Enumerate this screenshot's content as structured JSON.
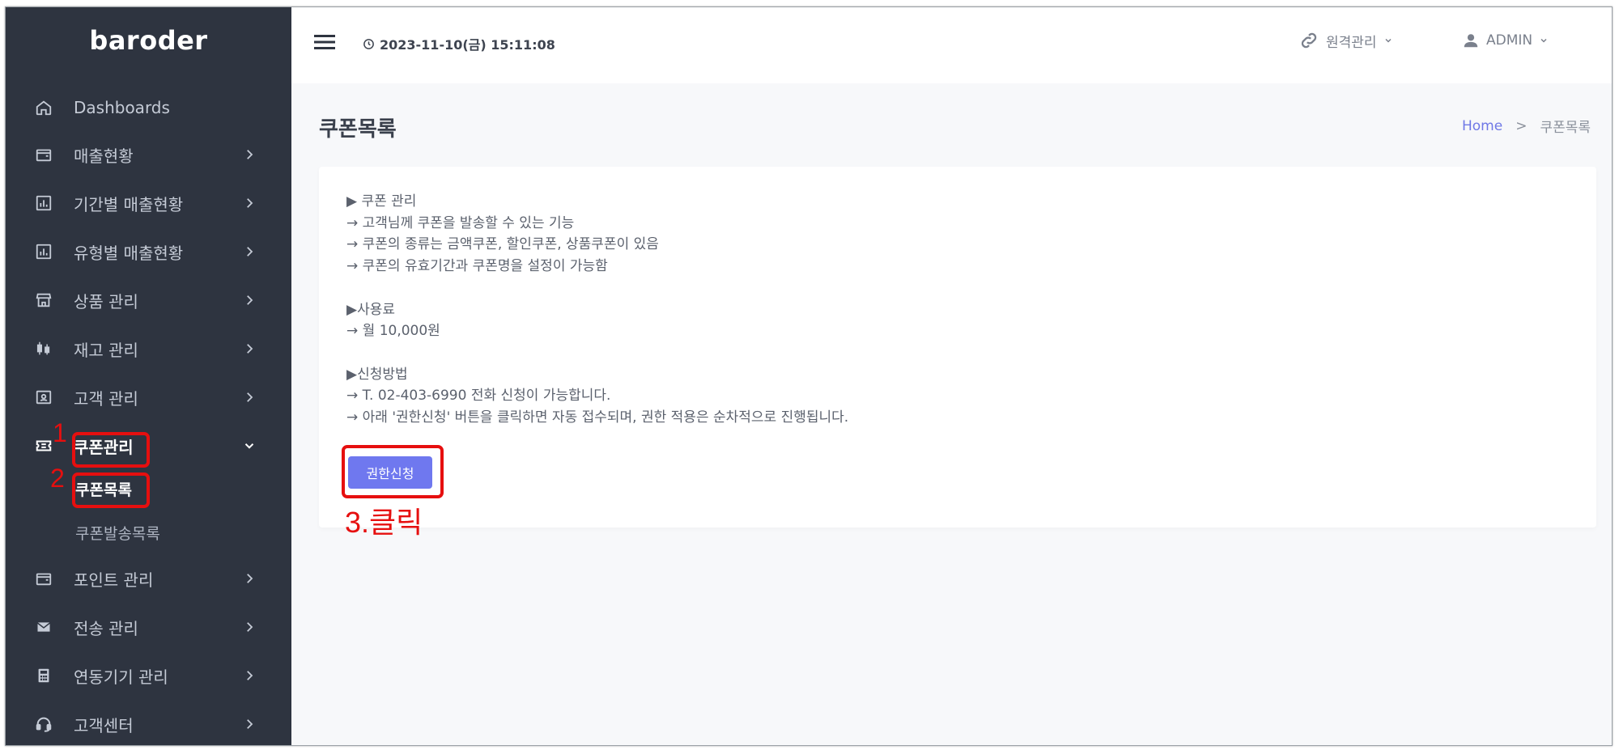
{
  "app": {
    "logo": "baroder"
  },
  "sidebar": {
    "items": [
      {
        "label": "Dashboards",
        "icon": "home-icon",
        "chevron": false
      },
      {
        "label": "매출현황",
        "icon": "wallet-icon",
        "chevron": true
      },
      {
        "label": "기간별 매출현황",
        "icon": "bar-chart-icon",
        "chevron": true
      },
      {
        "label": "유형별 매출현황",
        "icon": "bar-chart-icon",
        "chevron": true
      },
      {
        "label": "상품 관리",
        "icon": "store-icon",
        "chevron": true
      },
      {
        "label": "재고 관리",
        "icon": "candlestick-icon",
        "chevron": true
      },
      {
        "label": "고객 관리",
        "icon": "contact-card-icon",
        "chevron": true
      },
      {
        "label": "쿠폰관리",
        "icon": "ticket-icon",
        "chevron": true,
        "expanded": true
      },
      {
        "label": "포인트 관리",
        "icon": "wallet-icon",
        "chevron": true
      },
      {
        "label": "전송 관리",
        "icon": "mail-icon",
        "chevron": true
      },
      {
        "label": "연동기기 관리",
        "icon": "calculator-icon",
        "chevron": true
      },
      {
        "label": "고객센터",
        "icon": "headset-icon",
        "chevron": true
      }
    ],
    "coupon_sub": [
      "쿠폰목록",
      "쿠폰발송목록"
    ]
  },
  "topbar": {
    "datetime": "2023-11-10(금) 15:11:08",
    "remote_label": "원격관리",
    "admin_label": "ADMIN"
  },
  "page": {
    "title": "쿠폰목록",
    "breadcrumb_home": "Home",
    "breadcrumb_sep": ">",
    "breadcrumb_current": "쿠폰목록"
  },
  "card": {
    "lines": [
      "▶ 쿠폰 관리",
      "→ 고객님께 쿠폰을 발송할 수 있는 기능",
      "→ 쿠폰의 종류는 금액쿠폰, 할인쿠폰, 상품쿠폰이 있음",
      "→ 쿠폰의 유효기간과 쿠폰명을 설정이 가능함",
      "",
      "▶사용료",
      "→ 월 10,000원",
      "",
      "▶신청방법",
      "→ T. 02-403-6990 전화 신청이 가능합니다.",
      "→ 아래 '권한신청' 버튼을 클릭하면 자동 접수되며, 권한 적용은 순차적으로 진행됩니다."
    ],
    "apply_button": "권한신청"
  },
  "annotations": {
    "step1": "1",
    "step2": "2",
    "step3": "3.클릭"
  },
  "colors": {
    "sidebar_bg": "#2e3440",
    "accent": "#6f78ef",
    "annotation": "#e60f0f"
  }
}
